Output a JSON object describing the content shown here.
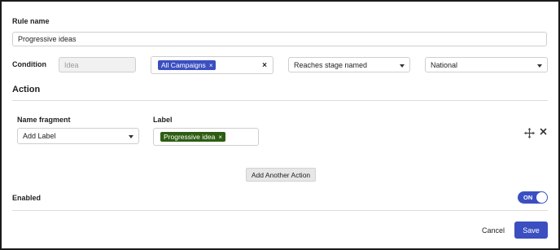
{
  "rule_name": {
    "label": "Rule name",
    "value": "Progressive ideas"
  },
  "condition": {
    "label": "Condition",
    "type_value": "Idea",
    "campaign_chip": "All Campaigns",
    "clear_symbol": "×",
    "stage_select": "Reaches stage named",
    "stage_value": "National"
  },
  "action": {
    "title": "Action",
    "name_fragment_label": "Name fragment",
    "name_fragment_value": "Add Label",
    "label_label": "Label",
    "label_chip": "Progressive idea",
    "add_action_button": "Add Another Action"
  },
  "enabled": {
    "label": "Enabled",
    "toggle_text": "ON",
    "is_on": true
  },
  "footer": {
    "cancel": "Cancel",
    "save": "Save"
  },
  "icons": {
    "move": "move-icon",
    "close": "close-icon",
    "chip_remove": "×"
  },
  "colors": {
    "primary": "#3b4fc1",
    "chip_green": "#2d5d12",
    "divider": "#dddddd"
  }
}
